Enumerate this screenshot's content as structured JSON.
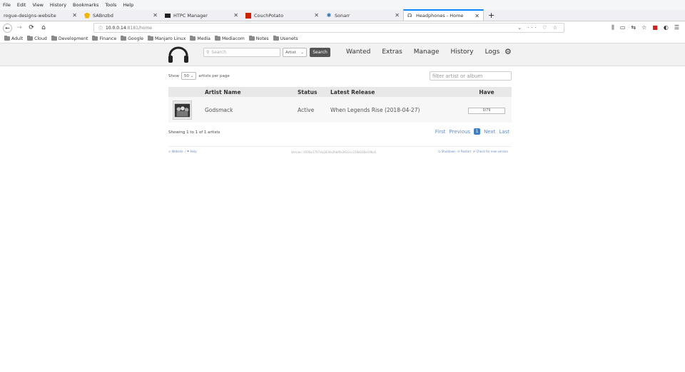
{
  "menu": [
    "File",
    "Edit",
    "View",
    "History",
    "Bookmarks",
    "Tools",
    "Help"
  ],
  "tabs": [
    {
      "title": "rogue-designs-website",
      "color": ""
    },
    {
      "title": "SABnzbd",
      "color": "#f0b400"
    },
    {
      "title": "HTPC Manager",
      "color": "#222222"
    },
    {
      "title": "CouchPotato",
      "color": "#cc2200"
    },
    {
      "title": "Sonarr",
      "color": "#2a6fb0"
    },
    {
      "title": "Headphones - Home",
      "color": "#333333"
    }
  ],
  "url": {
    "host": "10.0.0.14",
    "path": ":8181/home"
  },
  "bookmarks": [
    "Adult",
    "Cloud",
    "Development",
    "Finance",
    "Google",
    "Manjaro Linux",
    "Media",
    "Mediacom",
    "Notes",
    "Usenets"
  ],
  "header": {
    "search_placeholder": "Search",
    "search_type": "Artist",
    "search_button": "Search",
    "nav": [
      "Wanted",
      "Extras",
      "Manage",
      "History",
      "Logs"
    ]
  },
  "controls": {
    "show_label": "Show",
    "page_size": "50",
    "per_page_label": "artists per page",
    "filter_placeholder": "filter artist or album"
  },
  "table": {
    "columns": [
      "",
      "Artist Name",
      "Status",
      "Latest Release",
      "Have"
    ],
    "rows": [
      {
        "artist": "Godsmack",
        "status": "Active",
        "latest": "When Legends Rise (2018-04-27)",
        "have": "0/79",
        "have_fraction": 0
      }
    ]
  },
  "info": "Showing 1 to 1 of 1 artists",
  "pager": {
    "first": "First",
    "previous": "Previous",
    "current": "1",
    "next": "Next",
    "last": "Last"
  },
  "footer": {
    "website": "Website",
    "help": "Help",
    "version": "Version: b506e1797da183da2bbf0e3632cc228d206e19ba5",
    "shutdown": "Shutdown",
    "restart": "Restart",
    "check": "Check for new version"
  }
}
